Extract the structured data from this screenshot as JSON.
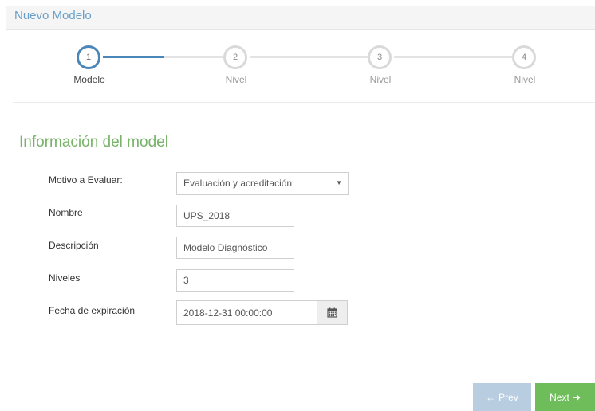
{
  "header": {
    "title": "Nuevo Modelo"
  },
  "wizard": {
    "steps": [
      {
        "number": "1",
        "label": "Modelo",
        "active": true
      },
      {
        "number": "2",
        "label": "Nivel",
        "active": false
      },
      {
        "number": "3",
        "label": "Nivel",
        "active": false
      },
      {
        "number": "4",
        "label": "Nivel",
        "active": false
      }
    ]
  },
  "section": {
    "title": "Información del model"
  },
  "form": {
    "motivo": {
      "label": "Motivo a Evaluar:",
      "value": "Evaluación y acreditación"
    },
    "nombre": {
      "label": "Nombre",
      "value": "UPS_2018"
    },
    "descripcion": {
      "label": "Descripción",
      "value": "Modelo Diagnóstico"
    },
    "niveles": {
      "label": "Niveles",
      "value": "3"
    },
    "fecha": {
      "label": "Fecha de expiración",
      "value": "2018-12-31 00:00:00"
    }
  },
  "icons": {
    "calendar": "calendar-icon",
    "arrow_left": "arrow-left-icon",
    "arrow_right": "arrow-right-icon",
    "caret": "caret-down-icon"
  },
  "colors": {
    "accent_blue": "#4a86b8",
    "accent_green": "#6ebd5a",
    "title_green": "#78b36a",
    "prev_disabled": "#b9cde0"
  },
  "buttons": {
    "prev": "Prev",
    "next": "Next"
  }
}
